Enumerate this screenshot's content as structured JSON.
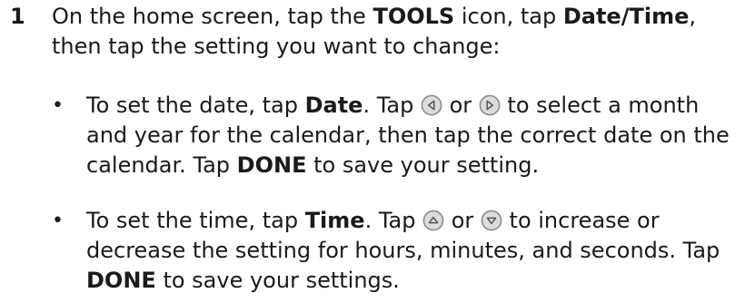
{
  "step": {
    "number": "1",
    "intro": {
      "t1": "On the home screen, tap the ",
      "b1": "TOOLS",
      "t2": " icon, tap ",
      "b2": "Date/Time",
      "t3": ", then tap the setting you want to change:"
    },
    "bullets": [
      {
        "marker": "•",
        "t1": "To set the date, tap ",
        "b1": "Date",
        "t2": ". Tap ",
        "icon1": "left-arrow-icon",
        "t3": " or ",
        "icon2": "right-arrow-icon",
        "t4": " to select a month and year for the calendar, then tap the correct date on the calendar. Tap ",
        "b2": "DONE",
        "t5": " to save your setting."
      },
      {
        "marker": "•",
        "t1": "To set the time, tap ",
        "b1": "Time",
        "t2": ". Tap ",
        "icon1": "up-arrow-icon",
        "t3": " or ",
        "icon2": "down-arrow-icon",
        "t4": " to increase or decrease the setting for hours, minutes, and seconds. Tap ",
        "b2": "DONE",
        "t5": " to save your settings."
      }
    ]
  },
  "colors": {
    "text": "#1a1a1a",
    "icon_fill": "#dcdcdc",
    "icon_stroke": "#8c8c8c"
  }
}
